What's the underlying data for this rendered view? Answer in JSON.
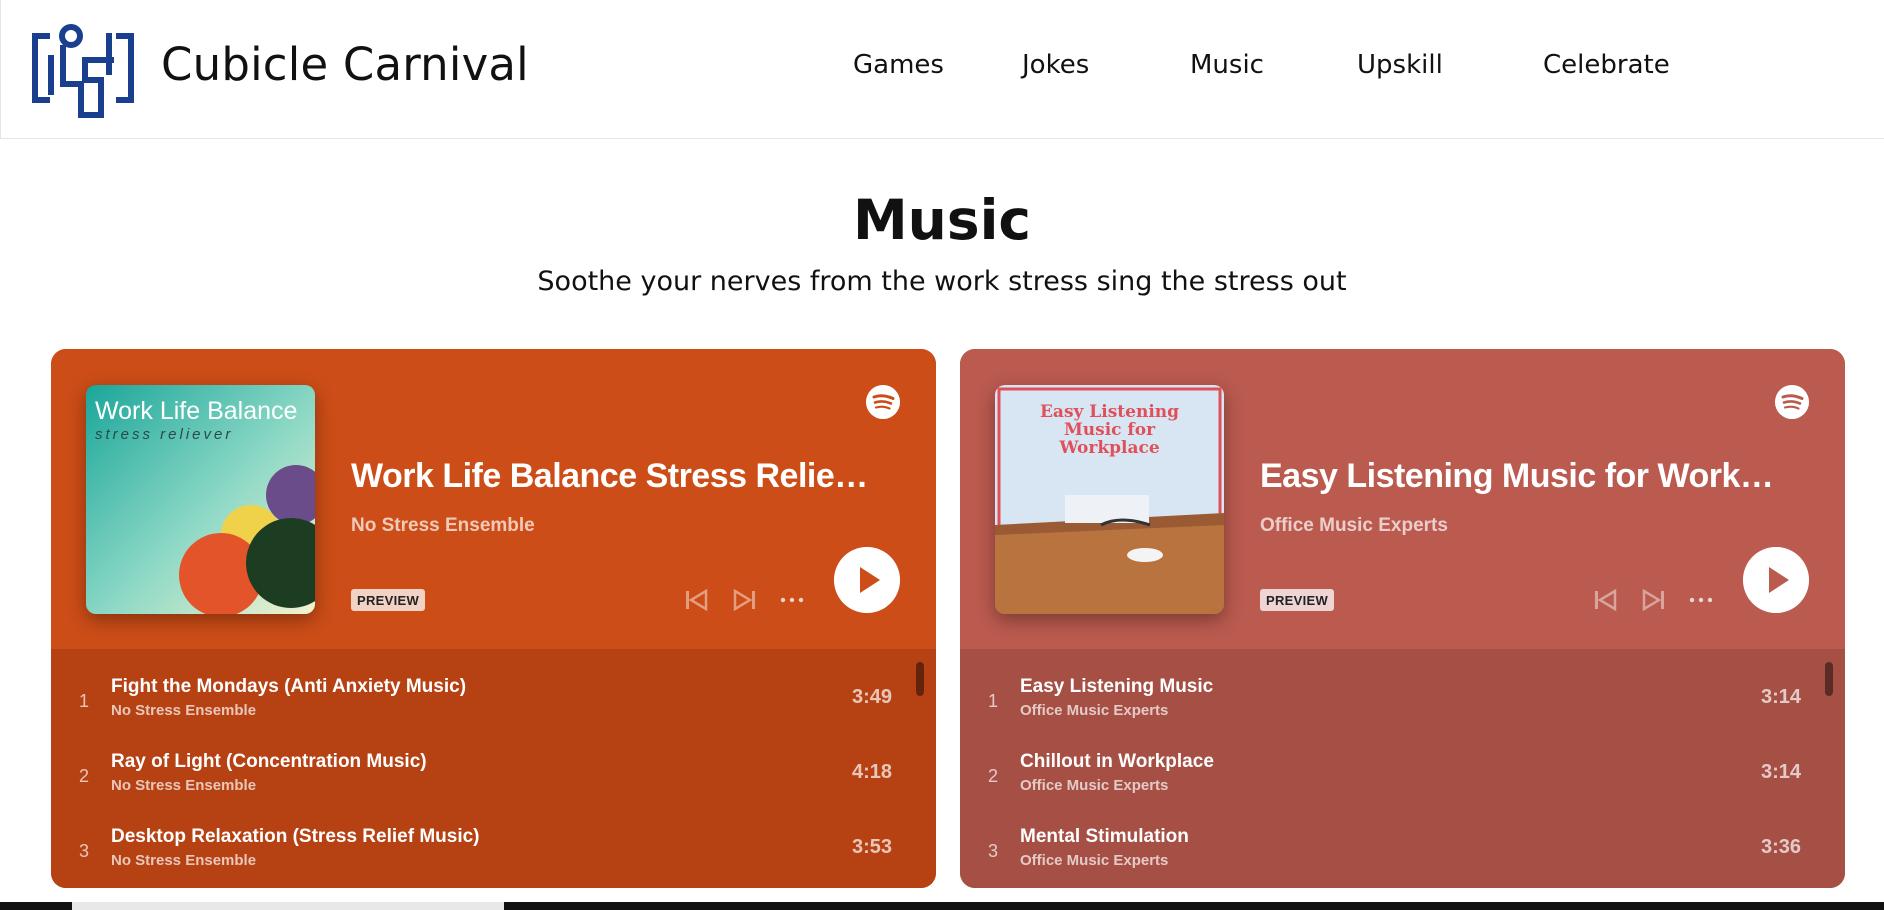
{
  "header": {
    "brand": "Cubicle Carnival",
    "nav": [
      "Games",
      "Jokes",
      "Music",
      "Upskill",
      "Celebrate"
    ]
  },
  "hero": {
    "title": "Music",
    "subtitle": "Soothe your nerves from the work stress sing the stress out"
  },
  "players": [
    {
      "bg_color": "#cc4d17",
      "list_color": "#b64214",
      "cover_title": "Work Life Balance",
      "cover_subtitle": "stress reliever",
      "title": "Work Life Balance Stress Reliever",
      "artist": "No Stress Ensemble",
      "badge": "PREVIEW",
      "tracks": [
        {
          "num": "1",
          "name": "Fight the Mondays (Anti Anxiety Music)",
          "artist": "No Stress Ensemble",
          "duration": "3:49"
        },
        {
          "num": "2",
          "name": "Ray of Light (Concentration Music)",
          "artist": "No Stress Ensemble",
          "duration": "4:18"
        },
        {
          "num": "3",
          "name": "Desktop Relaxation (Stress Relief Music)",
          "artist": "No Stress Ensemble",
          "duration": "3:53"
        }
      ]
    },
    {
      "bg_color": "#bb5a4f",
      "list_color": "#a64f45",
      "cover_title": "Easy Listening Music for Workplace",
      "title": "Easy Listening Music for Workplace",
      "artist": "Office Music Experts",
      "badge": "PREVIEW",
      "tracks": [
        {
          "num": "1",
          "name": "Easy Listening Music",
          "artist": "Office Music Experts",
          "duration": "3:14"
        },
        {
          "num": "2",
          "name": "Chillout in Workplace",
          "artist": "Office Music Experts",
          "duration": "3:14"
        },
        {
          "num": "3",
          "name": "Mental Stimulation",
          "artist": "Office Music Experts",
          "duration": "3:36"
        }
      ]
    }
  ],
  "colors": {
    "logo_blue": "#1a3f8f",
    "text": "#111111"
  },
  "icons": [
    "logo-icon",
    "spotify-icon",
    "previous-icon",
    "next-icon",
    "more-icon",
    "play-icon"
  ]
}
